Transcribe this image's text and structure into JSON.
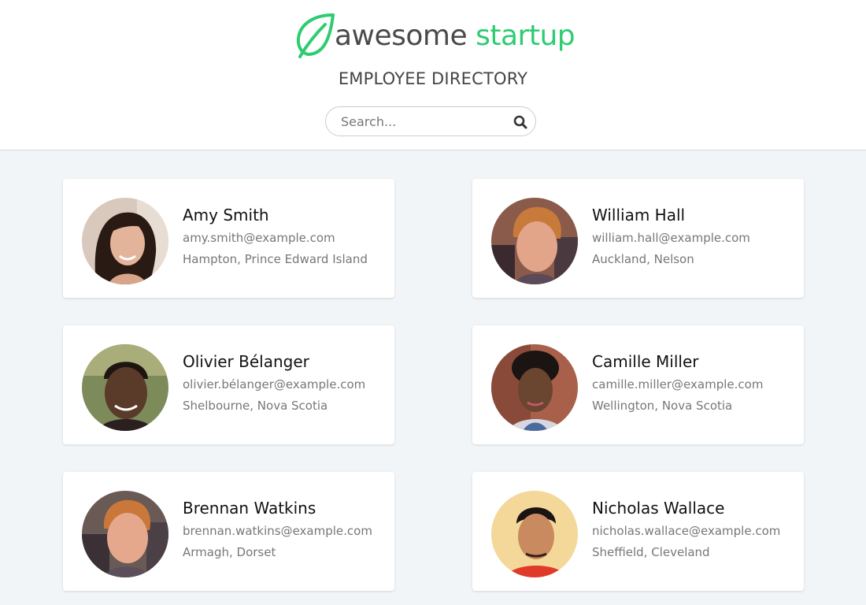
{
  "brand": {
    "word1": "awesome",
    "word2": "startup",
    "accent": "#2ecc71"
  },
  "header": {
    "title": "EMPLOYEE DIRECTORY"
  },
  "search": {
    "placeholder": "Search...",
    "value": ""
  },
  "employees": [
    {
      "name": "Amy Smith",
      "email": "amy.smith@example.com",
      "location": "Hampton, Prince Edward Island"
    },
    {
      "name": "William Hall",
      "email": "william.hall@example.com",
      "location": "Auckland, Nelson"
    },
    {
      "name": "Olivier Bélanger",
      "email": "olivier.bélanger@example.com",
      "location": "Shelbourne, Nova Scotia"
    },
    {
      "name": "Camille Miller",
      "email": "camille.miller@example.com",
      "location": "Wellington, Nova Scotia"
    },
    {
      "name": "Brennan Watkins",
      "email": "brennan.watkins@example.com",
      "location": "Armagh, Dorset"
    },
    {
      "name": "Nicholas Wallace",
      "email": "nicholas.wallace@example.com",
      "location": "Sheffield, Cleveland"
    }
  ]
}
